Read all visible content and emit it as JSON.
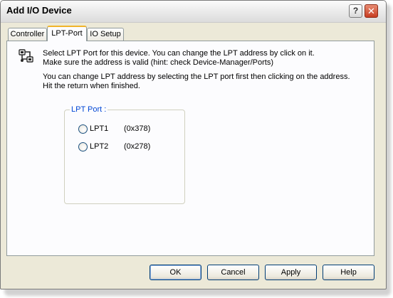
{
  "window": {
    "title": "Add I/O Device",
    "help_glyph": "?",
    "close_glyph": "✕"
  },
  "tabs": [
    {
      "label": "Controller",
      "active": false
    },
    {
      "label": "LPT-Port",
      "active": true
    },
    {
      "label": "IO Setup",
      "active": false
    }
  ],
  "info": {
    "icon": "network-plug-icon",
    "line1": "Select LPT Port for this device. You can change the LPT address by click on it.",
    "line2": "Make sure the address is valid (hint: check Device-Manager/Ports)",
    "line3": "You can change LPT address by selecting the LPT port first then clicking on the address.",
    "line4": "Hit the return when finished."
  },
  "lpt_group": {
    "legend": "LPT Port :",
    "ports": [
      {
        "name": "LPT1",
        "address": "(0x378)",
        "selected": false
      },
      {
        "name": "LPT2",
        "address": "(0x278)",
        "selected": false
      }
    ]
  },
  "buttons": {
    "ok": "OK",
    "cancel": "Cancel",
    "apply": "Apply",
    "help": "Help"
  },
  "colors": {
    "legend_blue": "#0046d5",
    "active_tab_highlight": "#f0b429",
    "close_red": "#c73d22",
    "dialog_face": "#ece9d8"
  }
}
